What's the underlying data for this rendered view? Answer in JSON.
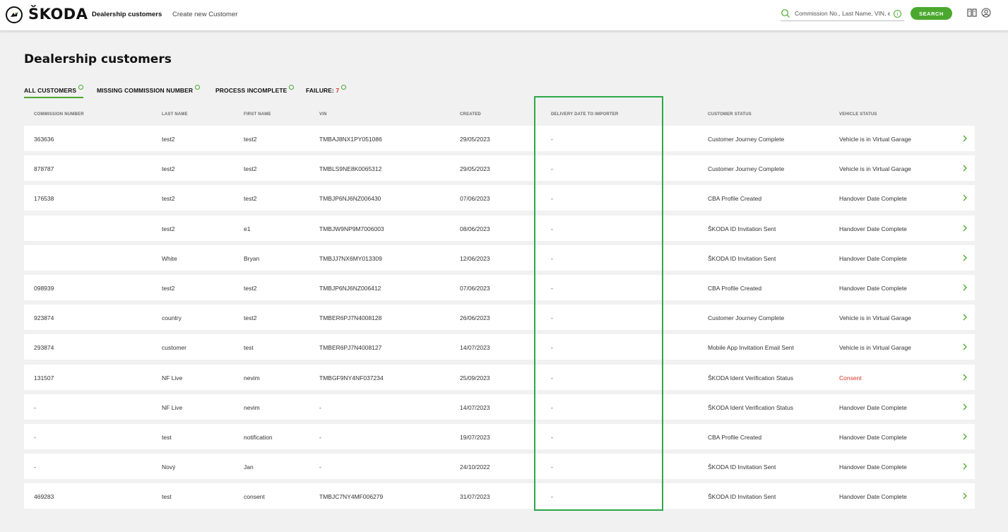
{
  "header": {
    "brand": "ŠKODA",
    "nav_active": "Dealership customers",
    "nav_create": "Create new Customer",
    "search_placeholder": "Commission No., Last Name, VIN, etc.",
    "search_button": "SEARCH",
    "icons": [
      "skoda-logo-icon",
      "search-icon",
      "info-icon",
      "book-icon",
      "user-icon"
    ]
  },
  "page": {
    "title": "Dealership customers"
  },
  "tabs": {
    "all": "ALL CUSTOMERS",
    "missing": "MISSING COMMISSION NUMBER",
    "process": "PROCESS INCOMPLETE",
    "failure_label": "FAILURE: ",
    "failure_count": "7"
  },
  "columns": [
    "COMMISSION NUMBER",
    "LAST NAME",
    "FIRST NAME",
    "VIN",
    "CREATED",
    "DELIVERY DATE TO IMPORTER",
    "CUSTOMER STATUS",
    "VEHICLE STATUS"
  ],
  "rows": [
    {
      "commission": "363636",
      "last": "test2",
      "first": "test2",
      "vin": "TMBAJ8NX1PY051086",
      "created": "29/05/2023",
      "delivery": "-",
      "customer_status": "Customer Journey Complete",
      "vehicle_status": "Vehicle is in Virtual Garage"
    },
    {
      "commission": "878787",
      "last": "test2",
      "first": "test2",
      "vin": "TMBLS9NE8K0065312",
      "created": "29/05/2023",
      "delivery": "-",
      "customer_status": "Customer Journey Complete",
      "vehicle_status": "Vehicle is in Virtual Garage"
    },
    {
      "commission": "176538",
      "last": "test2",
      "first": "test2",
      "vin": "TMBJP6NJ6NZ006430",
      "created": "07/06/2023",
      "delivery": "-",
      "customer_status": "CBA Profile Created",
      "vehicle_status": "Handover Date Complete"
    },
    {
      "commission": "",
      "last": "test2",
      "first": "e1",
      "vin": "TMBJW9NP9M7006003",
      "created": "08/06/2023",
      "delivery": "-",
      "customer_status": "ŠKODA ID Invitation Sent",
      "vehicle_status": "Handover Date Complete"
    },
    {
      "commission": "",
      "last": "White",
      "first": "Bryan",
      "vin": "TMBJJ7NX6MY013309",
      "created": "12/06/2023",
      "delivery": "-",
      "customer_status": "ŠKODA ID Invitation Sent",
      "vehicle_status": "Handover Date Complete"
    },
    {
      "commission": "098939",
      "last": "test2",
      "first": "test2",
      "vin": "TMBJP6NJ6NZ006412",
      "created": "07/06/2023",
      "delivery": "-",
      "customer_status": "CBA Profile Created",
      "vehicle_status": "Handover Date Complete"
    },
    {
      "commission": "923874",
      "last": "country",
      "first": "test2",
      "vin": "TMBER6PJ7N4008128",
      "created": "26/06/2023",
      "delivery": "-",
      "customer_status": "Customer Journey Complete",
      "vehicle_status": "Vehicle is in Virtual Garage"
    },
    {
      "commission": "293874",
      "last": "customer",
      "first": "test",
      "vin": "TMBER6PJ7N4008127",
      "created": "14/07/2023",
      "delivery": "-",
      "customer_status": "Mobile App Invitation Email Sent",
      "vehicle_status": "Vehicle is in Virtual Garage"
    },
    {
      "commission": "131507",
      "last": "NF Live",
      "first": "nevim",
      "vin": "TMBGF9NY4NF037234",
      "created": "25/09/2023",
      "delivery": "-",
      "customer_status": "ŠKODA Ident Verification Status",
      "vehicle_status": "Consent",
      "vehicle_status_color": "#d9342b"
    },
    {
      "commission": "-",
      "last": "NF Live",
      "first": "nevim",
      "vin": "-",
      "created": "14/07/2023",
      "delivery": "-",
      "customer_status": "ŠKODA Ident Verification Status",
      "vehicle_status": "Handover Date Complete"
    },
    {
      "commission": "-",
      "last": "test",
      "first": "notification",
      "vin": "-",
      "created": "19/07/2023",
      "delivery": "-",
      "customer_status": "CBA Profile Created",
      "vehicle_status": "Handover Date Complete"
    },
    {
      "commission": "-",
      "last": "Nový",
      "first": "Jan",
      "vin": "-",
      "created": "24/10/2022",
      "delivery": "-",
      "customer_status": "ŠKODA ID Invitation Sent",
      "vehicle_status": "Handover Date Complete"
    },
    {
      "commission": "469283",
      "last": "test",
      "first": "consent",
      "vin": "TMBJC7NY4MF006279",
      "created": "31/07/2023",
      "delivery": "-",
      "customer_status": "ŠKODA ID Invitation Sent",
      "vehicle_status": "Handover Date Complete"
    }
  ],
  "colors": {
    "accent": "#4ba82e",
    "highlight": "#2ea84a",
    "alert": "#d9342b"
  }
}
